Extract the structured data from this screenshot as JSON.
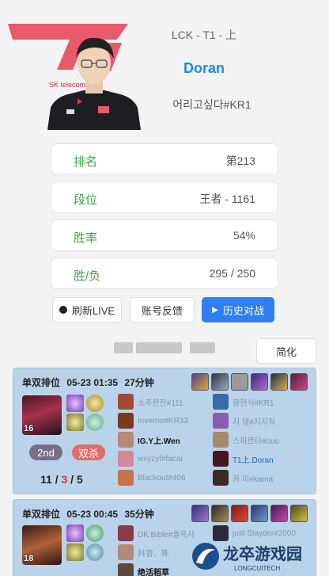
{
  "header": {
    "league": "LCK - T1 - 上",
    "player_name": "Doran",
    "riot_id": "어리고싶다#KR1",
    "sponsor_text": "SK telecom"
  },
  "stats": [
    {
      "label": "排名",
      "value": "第213"
    },
    {
      "label": "段位",
      "value": "王者 - 1161"
    },
    {
      "label": "胜率",
      "value": "54%"
    },
    {
      "label": "胜/负",
      "value": "295 / 250"
    }
  ],
  "actions": {
    "refresh": "刷新LIVE",
    "feedback": "账号反馈",
    "history": "历史对战",
    "simplify": "简化"
  },
  "matches": [
    {
      "queue": "单双排位",
      "datetime": "05-23 01:35",
      "duration": "27分钟",
      "level": "16",
      "rank": "2nd",
      "multikill": "双杀",
      "kda": {
        "k": "11",
        "d": "3",
        "a": "5"
      },
      "left_team": [
        "소주한잔#111",
        "Inverno#KR33",
        "IG.Y上.Wen",
        "wxyzyf#facai",
        "Blackout#406"
      ],
      "right_team": [
        "함현식#KR1",
        "지 댕#지지직",
        "스파르타#ouo",
        "T1上.Doran",
        "카 미#kama"
      ]
    },
    {
      "queue": "单双排位",
      "datetime": "05-23 00:45",
      "duration": "35分钟",
      "level": "18",
      "left_team": [
        "DK Bible#돌욕사",
        "抖音、陈",
        "绝活稻草"
      ],
      "right_team": [
        "just Slayder#2000",
        "",
        ""
      ]
    }
  ],
  "watermark": {
    "title": "龙卒游戏园",
    "subtitle": "LONGCUITECH"
  },
  "colors": {
    "accent_blue": "#2f7ff0",
    "name_blue": "#1e88e5",
    "label_green": "#3aa548",
    "card_bg": "#b9d4ea",
    "death_red": "#e03030"
  }
}
